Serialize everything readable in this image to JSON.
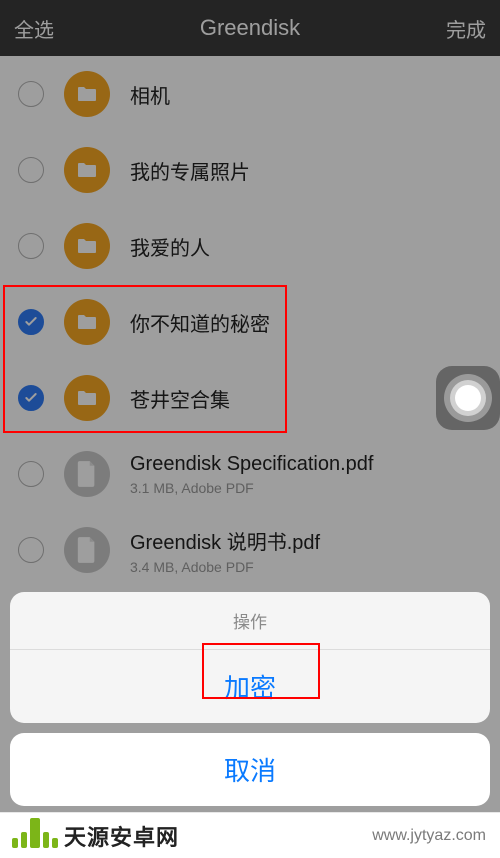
{
  "navbar": {
    "left": "全选",
    "title": "Greendisk",
    "right": "完成"
  },
  "list": [
    {
      "type": "folder",
      "name": "相机",
      "checked": false
    },
    {
      "type": "folder",
      "name": "我的专属照片",
      "checked": false
    },
    {
      "type": "folder",
      "name": "我爱的人",
      "checked": false
    },
    {
      "type": "folder",
      "name": "你不知道的秘密",
      "checked": true
    },
    {
      "type": "folder",
      "name": "苍井空合集",
      "checked": true
    },
    {
      "type": "file",
      "name": "Greendisk Specification.pdf",
      "sub": "3.1 MB, Adobe PDF",
      "checked": false
    },
    {
      "type": "file",
      "name": "Greendisk 说明书.pdf",
      "sub": "3.4 MB, Adobe PDF",
      "checked": false
    }
  ],
  "sheet": {
    "header": "操作",
    "encrypt": "加密",
    "cancel": "取消"
  },
  "watermark": {
    "site_name": "天源安卓网",
    "url": "www.jytyaz.com"
  }
}
